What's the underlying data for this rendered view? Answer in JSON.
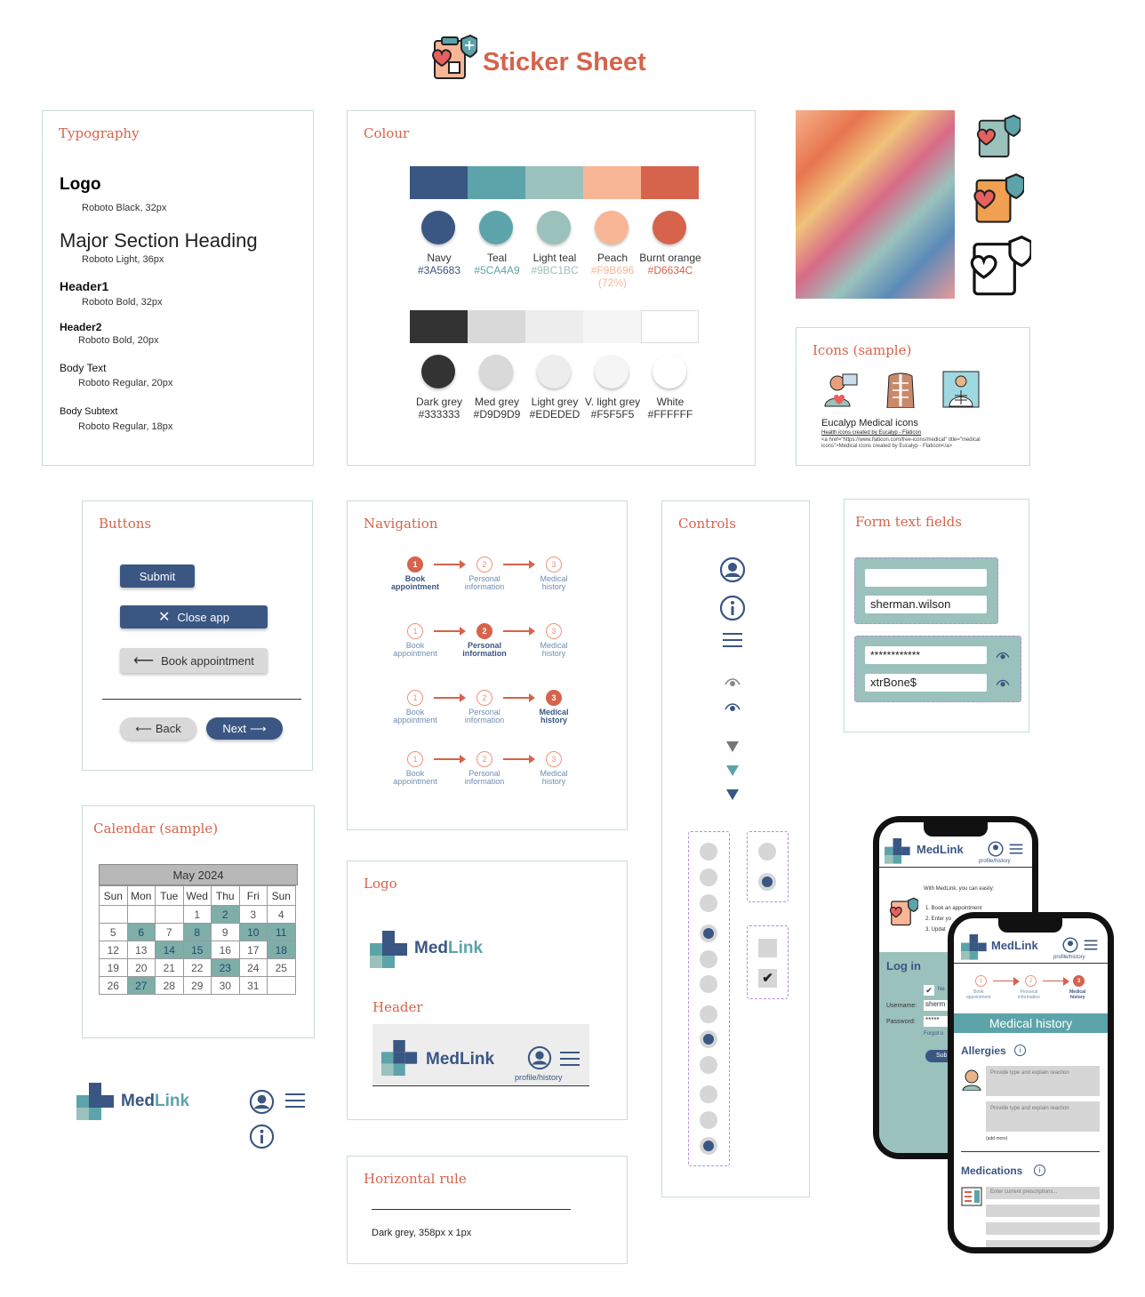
{
  "header": {
    "title": "Sticker Sheet"
  },
  "typography": {
    "title": "Typography",
    "logo": "Logo",
    "logo_spec": "Roboto Black, 32px",
    "major": "Major Section Heading",
    "major_spec": "Roboto Light, 36px",
    "h1": "Header1",
    "h1_spec": "Roboto Bold, 32px",
    "h2": "Header2",
    "h2_spec": "Roboto Bold, 20px",
    "body": "Body Text",
    "body_spec": "Roboto Regular, 20px",
    "sub": "Body Subtext",
    "sub_spec": "Roboto Regular, 18px"
  },
  "colour": {
    "title": "Colour",
    "primary": [
      {
        "name": "Navy",
        "hex": "#3A5683",
        "color": "#3A5683"
      },
      {
        "name": "Teal",
        "hex": "#5CA4A9",
        "color": "#5CA4A9"
      },
      {
        "name": "Light teal",
        "hex": "#9BC1BC",
        "color": "#9BC1BC"
      },
      {
        "name": "Peach",
        "hex": "#F9B696",
        "extra": "(72%)",
        "color": "#F9B696"
      },
      {
        "name": "Burnt orange",
        "hex": "#D6634C",
        "color": "#D6634C"
      }
    ],
    "neutral": [
      {
        "name": "Dark grey",
        "hex": "#333333",
        "color": "#333333"
      },
      {
        "name": "Med grey",
        "hex": "#D9D9D9",
        "color": "#D9D9D9"
      },
      {
        "name": "Light grey",
        "hex": "#EDEDED",
        "color": "#EDEDED"
      },
      {
        "name": "V. light grey",
        "hex": "#F5F5F5",
        "color": "#F5F5F5"
      },
      {
        "name": "White",
        "hex": "#FFFFFF",
        "color": "#FFFFFF"
      }
    ]
  },
  "icons": {
    "title": "Icons (sample)",
    "name": "Eucalyp Medical icons",
    "credit": "Health icons created by Eucalyp - Flaticon",
    "code": "<a href=\"https://www.flaticon.com/free-icons/medical\" title=\"medical icons\">Medical icons created by Eucalyp - Flaticon</a>"
  },
  "buttons": {
    "title": "Buttons",
    "submit": "Submit",
    "close": "Close app",
    "book": "Book appointment",
    "back": "Back",
    "next": "Next"
  },
  "navigation": {
    "title": "Navigation",
    "steps": [
      {
        "n": "1",
        "l1": "Book",
        "l2": "appointment"
      },
      {
        "n": "2",
        "l1": "Personal",
        "l2": "information"
      },
      {
        "n": "3",
        "l1": "Medical",
        "l2": "history"
      }
    ]
  },
  "controls": {
    "title": "Controls"
  },
  "form": {
    "title": "Form text fields",
    "username": "sherman.wilson",
    "password_masked": "************",
    "password_plain": "xtrBone$"
  },
  "calendar": {
    "title": "Calendar (sample)",
    "month": "May 2024",
    "days": [
      "Sun",
      "Mon",
      "Tue",
      "Wed",
      "Thu",
      "Fri",
      "Sun"
    ],
    "weeks": [
      [
        "",
        "",
        "",
        "1",
        "2",
        "3",
        "4"
      ],
      [
        "5",
        "6",
        "7",
        "8",
        "9",
        "10",
        "11"
      ],
      [
        "12",
        "13",
        "14",
        "15",
        "16",
        "17",
        "18"
      ],
      [
        "19",
        "20",
        "21",
        "22",
        "23",
        "24",
        "25"
      ],
      [
        "26",
        "27",
        "28",
        "29",
        "30",
        "31",
        ""
      ]
    ],
    "highlighted": [
      "2",
      "6",
      "8",
      "10",
      "11",
      "14",
      "15",
      "18",
      "23",
      "27"
    ]
  },
  "logo": {
    "title": "Logo",
    "brand": "MedLink"
  },
  "header_sample": {
    "title": "Header",
    "profile": "profile/history"
  },
  "hr": {
    "title": "Horizontal rule",
    "spec": "Dark grey, 358px x 1px"
  },
  "phone1": {
    "intro": "With MedLink, you can easily:",
    "item1": "1. Book an appointment",
    "item2": "2. Enter yo",
    "item3": "3. Updat",
    "login": "Log in",
    "username_label": "Username:",
    "password_label": "Password:",
    "username_val": "sherm",
    "forgot": "Forgot u",
    "submit": "Sub",
    "remember": "Ne"
  },
  "phone2": {
    "banner": "Medical history",
    "allergies": "Allergies",
    "placeholder1": "Provide type and explain reaction",
    "placeholder2": "Provide type and explain reaction",
    "add_more": "(add more)",
    "medications": "Medications",
    "meds_placeholder": "Enter current prescriptions..."
  }
}
